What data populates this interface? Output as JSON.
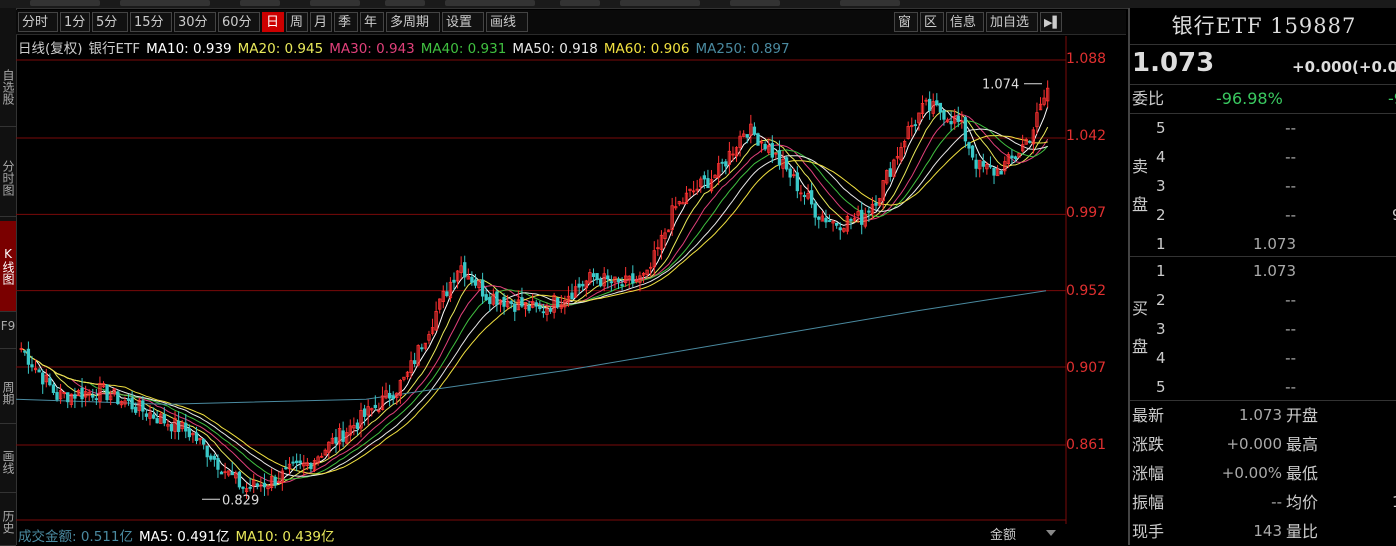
{
  "toolbar": {
    "items": [
      "分时",
      "1分",
      "5分",
      "15分",
      "30分",
      "60分",
      "日",
      "周",
      "月",
      "季",
      "年",
      "多周期",
      "设置",
      "画线"
    ],
    "active": "日",
    "right": [
      "窗",
      "区",
      "信息",
      "加自选"
    ]
  },
  "sidebar": {
    "items": [
      "自选股",
      "分时图",
      "K线图",
      "F9",
      "周期",
      "画线",
      "历史"
    ],
    "active": "K线图"
  },
  "ma_legend": [
    {
      "label": "日线(复权)",
      "color": "#cccccc"
    },
    {
      "label": "银行ETF",
      "color": "#cccccc"
    },
    {
      "label": "MA10: 0.939",
      "color": "#ffffff"
    },
    {
      "label": "MA20: 0.945",
      "color": "#e8e85a"
    },
    {
      "label": "MA30: 0.943",
      "color": "#e0407a"
    },
    {
      "label": "MA40: 0.931",
      "color": "#40c040"
    },
    {
      "label": "MA50: 0.918",
      "color": "#e8e8e8"
    },
    {
      "label": "MA60: 0.906",
      "color": "#f0e040"
    },
    {
      "label": "MA250: 0.897",
      "color": "#4a8aa0"
    }
  ],
  "volume_legend": [
    {
      "label": "成交金额: 0.511亿",
      "color": "#4a8aa0"
    },
    {
      "label": "MA5: 0.491亿",
      "color": "#ffffff"
    },
    {
      "label": "MA10: 0.439亿",
      "color": "#e8e85a"
    }
  ],
  "volume_selector": "金额",
  "price_axis": [
    "1.088",
    "1.042",
    "0.997",
    "0.952",
    "0.907",
    "0.861"
  ],
  "annotations": {
    "high": "1.074",
    "low": "0.829"
  },
  "colors": {
    "up": "#ff3232",
    "down": "#3ac8c8",
    "axis": "#e03030",
    "grid": "#7a0a0a"
  },
  "chart_data": {
    "type": "candlestick",
    "title": "银行ETF",
    "ylim": [
      0.8,
      1.1
    ],
    "yticks": [
      1.088,
      1.042,
      0.997,
      0.952,
      0.907,
      0.861
    ],
    "high_mark": 1.074,
    "low_mark": 0.829,
    "ma": {
      "MA10": 0.939,
      "MA20": 0.945,
      "MA30": 0.943,
      "MA40": 0.931,
      "MA50": 0.918,
      "MA60": 0.906,
      "MA250": 0.897
    }
  },
  "quote": {
    "title": "银行ETF 159887",
    "price": "1.073",
    "change": "+0.000(+0.0",
    "weibi_label": "委比",
    "weibi_value": "-96.98%",
    "weibi_extra": "-9",
    "sell_label": "卖盘",
    "buy_label": "买盘",
    "sell": [
      {
        "level": "5",
        "price": "--",
        "extra": ""
      },
      {
        "level": "4",
        "price": "--",
        "extra": ""
      },
      {
        "level": "3",
        "price": "--",
        "extra": ""
      },
      {
        "level": "2",
        "price": "--",
        "extra": "9"
      },
      {
        "level": "1",
        "price": "1.073",
        "extra": ""
      }
    ],
    "buy": [
      {
        "level": "1",
        "price": "1.073"
      },
      {
        "level": "2",
        "price": "--"
      },
      {
        "level": "3",
        "price": "--"
      },
      {
        "level": "4",
        "price": "--"
      },
      {
        "level": "5",
        "price": "--"
      }
    ],
    "stats": [
      {
        "label": "最新",
        "value": "1.073",
        "label2": "开盘",
        "value2": ""
      },
      {
        "label": "涨跌",
        "value": "+0.000",
        "label2": "最高",
        "value2": ""
      },
      {
        "label": "涨幅",
        "value": "+0.00%",
        "label2": "最低",
        "value2": ""
      },
      {
        "label": "振幅",
        "value": "--",
        "label2": "均价",
        "value2": "1"
      },
      {
        "label": "现手",
        "value": "143",
        "label2": "量比",
        "value2": ""
      }
    ]
  }
}
